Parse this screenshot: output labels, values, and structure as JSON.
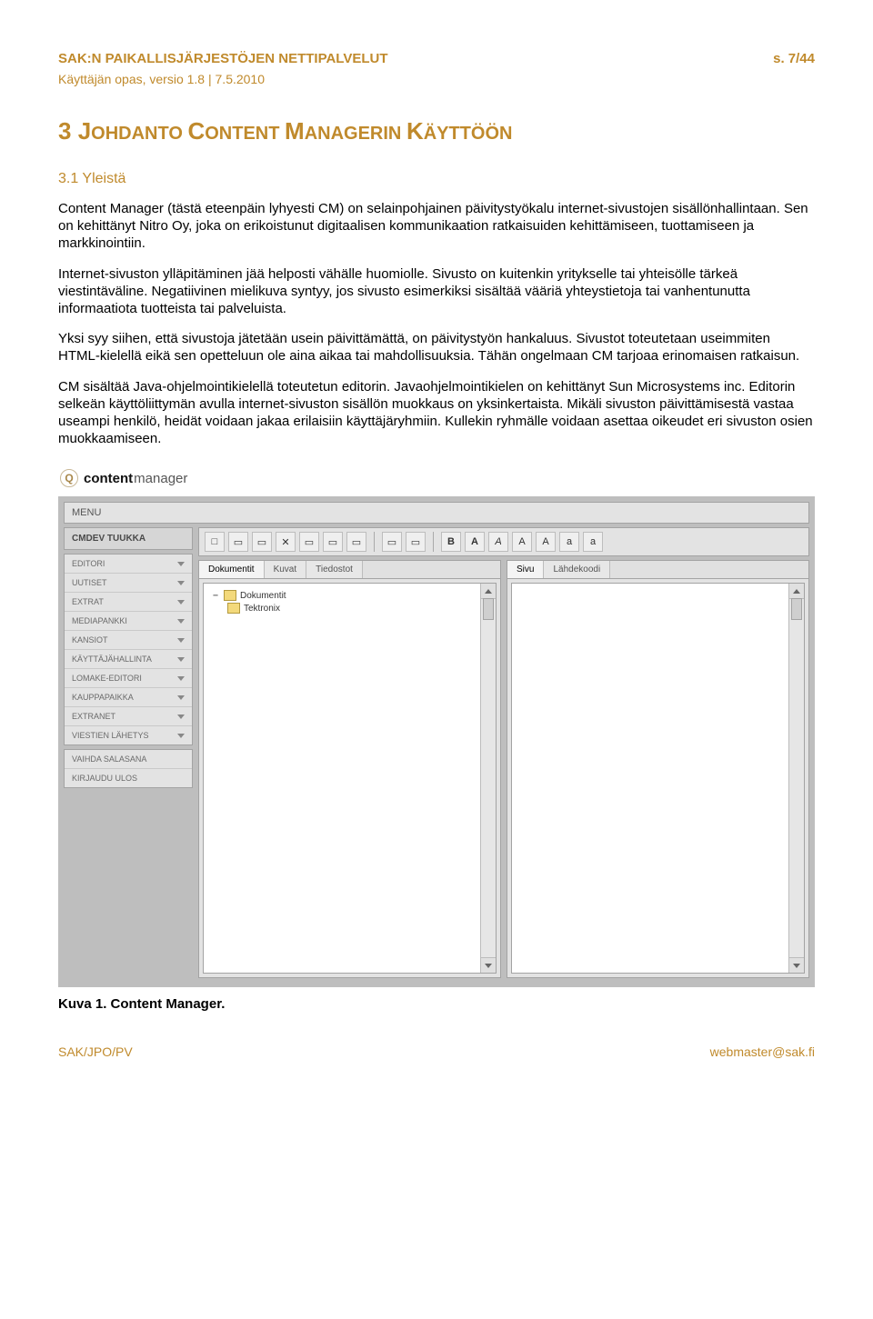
{
  "header": {
    "left": "SAK:N PAIKALLISJÄRJESTÖJEN NETTIPALVELUT",
    "right": "s. 7/44"
  },
  "subheader": "Käyttäjän opas, versio 1.8 | 7.5.2010",
  "chapter": {
    "num": "3 ",
    "cap1": "J",
    "rest1": "OHDANTO ",
    "cap2": "C",
    "rest2": "ONTENT ",
    "cap3": "M",
    "rest3": "ANAGERIN ",
    "cap4": "K",
    "rest4": "ÄYTTÖÖN"
  },
  "section": "3.1 Yleistä",
  "paragraphs": [
    "Content Manager (tästä eteenpäin lyhyesti CM) on selainpohjainen päivitystyökalu internet-sivustojen sisällönhallintaan. Sen on kehittänyt Nitro Oy, joka on erikoistunut digitaalisen kommunikaation ratkaisuiden kehittämiseen, tuottamiseen ja markkinointiin.",
    "Internet-sivuston ylläpitäminen jää helposti vähälle huomiolle. Sivusto on kuitenkin yritykselle tai yhteisölle tärkeä viestintäväline. Negatiivinen mielikuva syntyy, jos sivusto esimerkiksi sisältää vääriä yhteystietoja tai vanhentunutta informaatiota tuotteista tai palveluista.",
    "Yksi syy siihen, että sivustoja jätetään usein päivittämättä, on päivitystyön hankaluus. Sivustot toteutetaan useimmiten HTML-kielellä eikä sen opetteluun ole aina aikaa tai mahdollisuuksia. Tähän ongelmaan CM tarjoaa erinomaisen ratkaisun.",
    "CM sisältää Java-ohjelmointikielellä toteutetun editorin. Javaohjelmointikielen on kehittänyt Sun Microsystems inc. Editorin selkeän käyttöliittymän avulla internet-sivuston sisällön muokkaus on yksinkertaista. Mikäli sivuston päivittämisestä vastaa useampi henkilö, heidät voidaan jakaa erilaisiin käyttäjäryhmiin. Kullekin ryhmälle voidaan asettaa oikeudet eri sivuston osien muokkaamiseen."
  ],
  "logo": {
    "glyph": "Q",
    "bold": "content",
    "rest": "manager"
  },
  "app": {
    "menu": "MENU",
    "sidebar_title": "CMDEV TUUKKA",
    "items1": [
      "EDITORI",
      "UUTISET",
      "EXTRAT",
      "MEDIAPANKKI",
      "KANSIOT",
      "KÄYTTÄJÄHALLINTA",
      "LOMAKE-EDITORI",
      "KAUPPAPAIKKA",
      "EXTRANET",
      "VIESTIEN LÄHETYS"
    ],
    "items2": [
      "VAIHDA SALASANA",
      "KIRJAUDU ULOS"
    ],
    "toolbar_icons": [
      "□",
      "▭",
      "▭",
      "✕",
      "▭",
      "▭",
      "▭",
      "|",
      "▭",
      "▭",
      "|",
      "B",
      "A",
      "A",
      "A",
      "A",
      "a",
      "a"
    ],
    "left_tabs": [
      "Dokumentit",
      "Kuvat",
      "Tiedostot"
    ],
    "right_tabs": [
      "Sivu",
      "Lähdekoodi"
    ],
    "tree_root": "Dokumentit",
    "tree_child": "Tektronix"
  },
  "caption": "Kuva 1. Content Manager.",
  "footer": {
    "left": "SAK/JPO/PV",
    "right": "webmaster@sak.fi"
  }
}
